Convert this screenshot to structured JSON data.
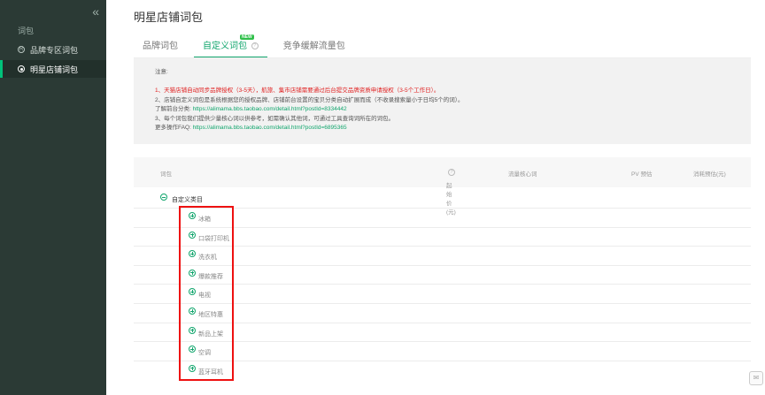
{
  "sidebar": {
    "collapse_icon": "«",
    "section": "词包",
    "items": [
      {
        "label": "品牌专区词包",
        "icon": "R",
        "active": false
      },
      {
        "label": "明星店铺词包",
        "icon": "",
        "active": true
      }
    ]
  },
  "page": {
    "title": "明星店铺词包"
  },
  "tabs": [
    {
      "label": "品牌词包",
      "active": false
    },
    {
      "label": "自定义词包",
      "active": true,
      "badge": "NEW",
      "help": "?"
    },
    {
      "label": "竞争缓解流量包",
      "active": false
    }
  ],
  "notice": {
    "title": "注意:",
    "line1": "1、天猫店铺自动同步品牌授权（3-5天），航旅、集市店铺需要通过后台提交品牌资质申请授权（3-5个工作日）。",
    "line2": "2、店铺自定义词包是系统根据您的授权品牌、店铺前台设置的宝贝分类自动扩展而成（不收录搜索量小于日均5个的词）。",
    "line3_prefix": "了解前台分类: ",
    "line3_link": "https://alimama.bbs.taobao.com/detail.html?postId=8334442",
    "line4": "3、每个词包我们提供少量核心词以供参考，如需确认其他词，可通过工具查询词所在的词包。",
    "line5_prefix": "更多操作FAQ: ",
    "line5_link": "https://alimama.bbs.taobao.com/detail.html?postId=6895365"
  },
  "table": {
    "headers": {
      "word_pack": "词包",
      "start_price": "起始价(元)",
      "help": "?",
      "core_words": "流量核心词",
      "pv": "PV 预估",
      "cost": "消耗预估(元)"
    },
    "group": "自定义类目",
    "rows": [
      "冰箱",
      "口袋打印机",
      "洗衣机",
      "爆款推荐",
      "电视",
      "地区特惠",
      "新品上架",
      "空调",
      "蓝牙耳机"
    ]
  },
  "side_tool": "✉"
}
